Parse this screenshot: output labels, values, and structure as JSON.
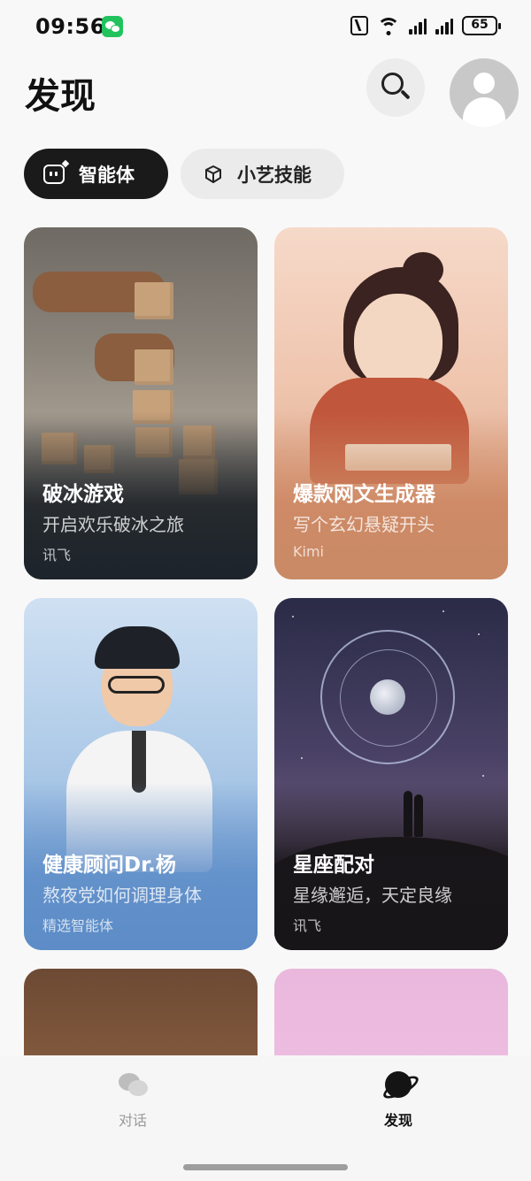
{
  "status_bar": {
    "time": "09:56",
    "battery": "65",
    "icons": [
      "wechat-icon",
      "nfc-icon",
      "wifi-icon",
      "signal-icon",
      "signal-icon",
      "battery-icon"
    ]
  },
  "header": {
    "title": "发现",
    "search_icon": "search-icon",
    "avatar_icon": "user-avatar-icon"
  },
  "tabs": [
    {
      "label": "智能体",
      "icon": "agent-icon",
      "active": true
    },
    {
      "label": "小艺技能",
      "icon": "cube-icon",
      "active": false
    }
  ],
  "cards": [
    {
      "title": "破冰游戏",
      "subtitle": "开启欢乐破冰之旅",
      "source": "讯飞"
    },
    {
      "title": "爆款网文生成器",
      "subtitle": "写个玄幻悬疑开头",
      "source": "Kimi"
    },
    {
      "title": "健康顾问Dr.杨",
      "subtitle": "熬夜党如何调理身体",
      "source": "精选智能体"
    },
    {
      "title": "星座配对",
      "subtitle": "星缘邂逅，天定良缘",
      "source": "讯飞"
    }
  ],
  "bottom_nav": [
    {
      "label": "对话",
      "icon": "chat-icon",
      "active": false
    },
    {
      "label": "发现",
      "icon": "planet-icon",
      "active": true
    }
  ],
  "colors": {
    "active_chip": "#1a1a1a",
    "inactive_chip": "#ebebeb",
    "background": "#f8f8f8"
  }
}
